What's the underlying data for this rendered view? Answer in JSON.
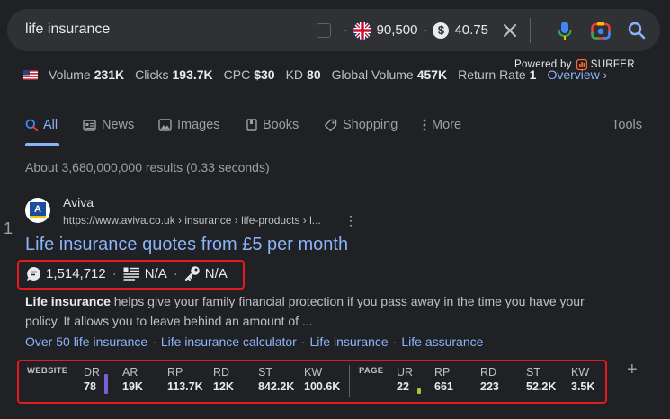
{
  "search": {
    "query": "life insurance",
    "uk_count": "90,500",
    "cpc_value": "40.75",
    "dollar_glyph": "$",
    "dot": "·"
  },
  "metrics": {
    "volume_label": "Volume",
    "volume": "231K",
    "clicks_label": "Clicks",
    "clicks": "193.7K",
    "cpc_label": "CPC",
    "cpc": "$30",
    "kd_label": "KD",
    "kd": "80",
    "global_label": "Global Volume",
    "global": "457K",
    "return_label": "Return Rate",
    "return": "1",
    "overview": "Overview ›"
  },
  "powered": {
    "prefix": "Powered by",
    "brand": "SURFER"
  },
  "tabs": {
    "all": "All",
    "news": "News",
    "images": "Images",
    "books": "Books",
    "shopping": "Shopping",
    "more": "More",
    "tools": "Tools"
  },
  "stats": "About 3,680,000,000 results (0.33 seconds)",
  "result": {
    "rank": "1",
    "favicon_letter": "A",
    "site_name": "Aviva",
    "url": "https://www.aviva.co.uk › insurance › life-products › l...",
    "kebab": "⋮",
    "title": "Life insurance quotes from £5 per month",
    "words": "1,514,712",
    "headings": "N/A",
    "keywords": "N/A",
    "snippet_bold": "Life insurance",
    "snippet_rest": " helps give your family financial protection if you pass away in the time you have your policy. It allows you to leave behind an amount of ...",
    "sitelinks": [
      "Over 50 life insurance",
      "Life insurance calculator",
      "Life insurance",
      "Life assurance"
    ]
  },
  "website_metrics": {
    "label": "WEBSITE",
    "cols": [
      {
        "h": "DR",
        "v": "78"
      },
      {
        "h": "AR",
        "v": "19K"
      },
      {
        "h": "RP",
        "v": "113.7K"
      },
      {
        "h": "RD",
        "v": "12K"
      },
      {
        "h": "ST",
        "v": "842.2K"
      },
      {
        "h": "KW",
        "v": "100.6K"
      }
    ],
    "dr_bar_fill": 0.78,
    "dr_bar_color": "#7b5fd6"
  },
  "page_metrics": {
    "label": "PAGE",
    "cols": [
      {
        "h": "UR",
        "v": "22"
      },
      {
        "h": "RP",
        "v": "661"
      },
      {
        "h": "RD",
        "v": "223"
      },
      {
        "h": "ST",
        "v": "52.2K"
      },
      {
        "h": "KW",
        "v": "3.5K"
      }
    ],
    "ur_bar_fill": 0.22,
    "ur_bar_color": "#a8c43a"
  },
  "colors": {
    "highlight_box": "#e41b1b",
    "link": "#8ab4f8",
    "background": "#202124"
  },
  "add_button": "+"
}
